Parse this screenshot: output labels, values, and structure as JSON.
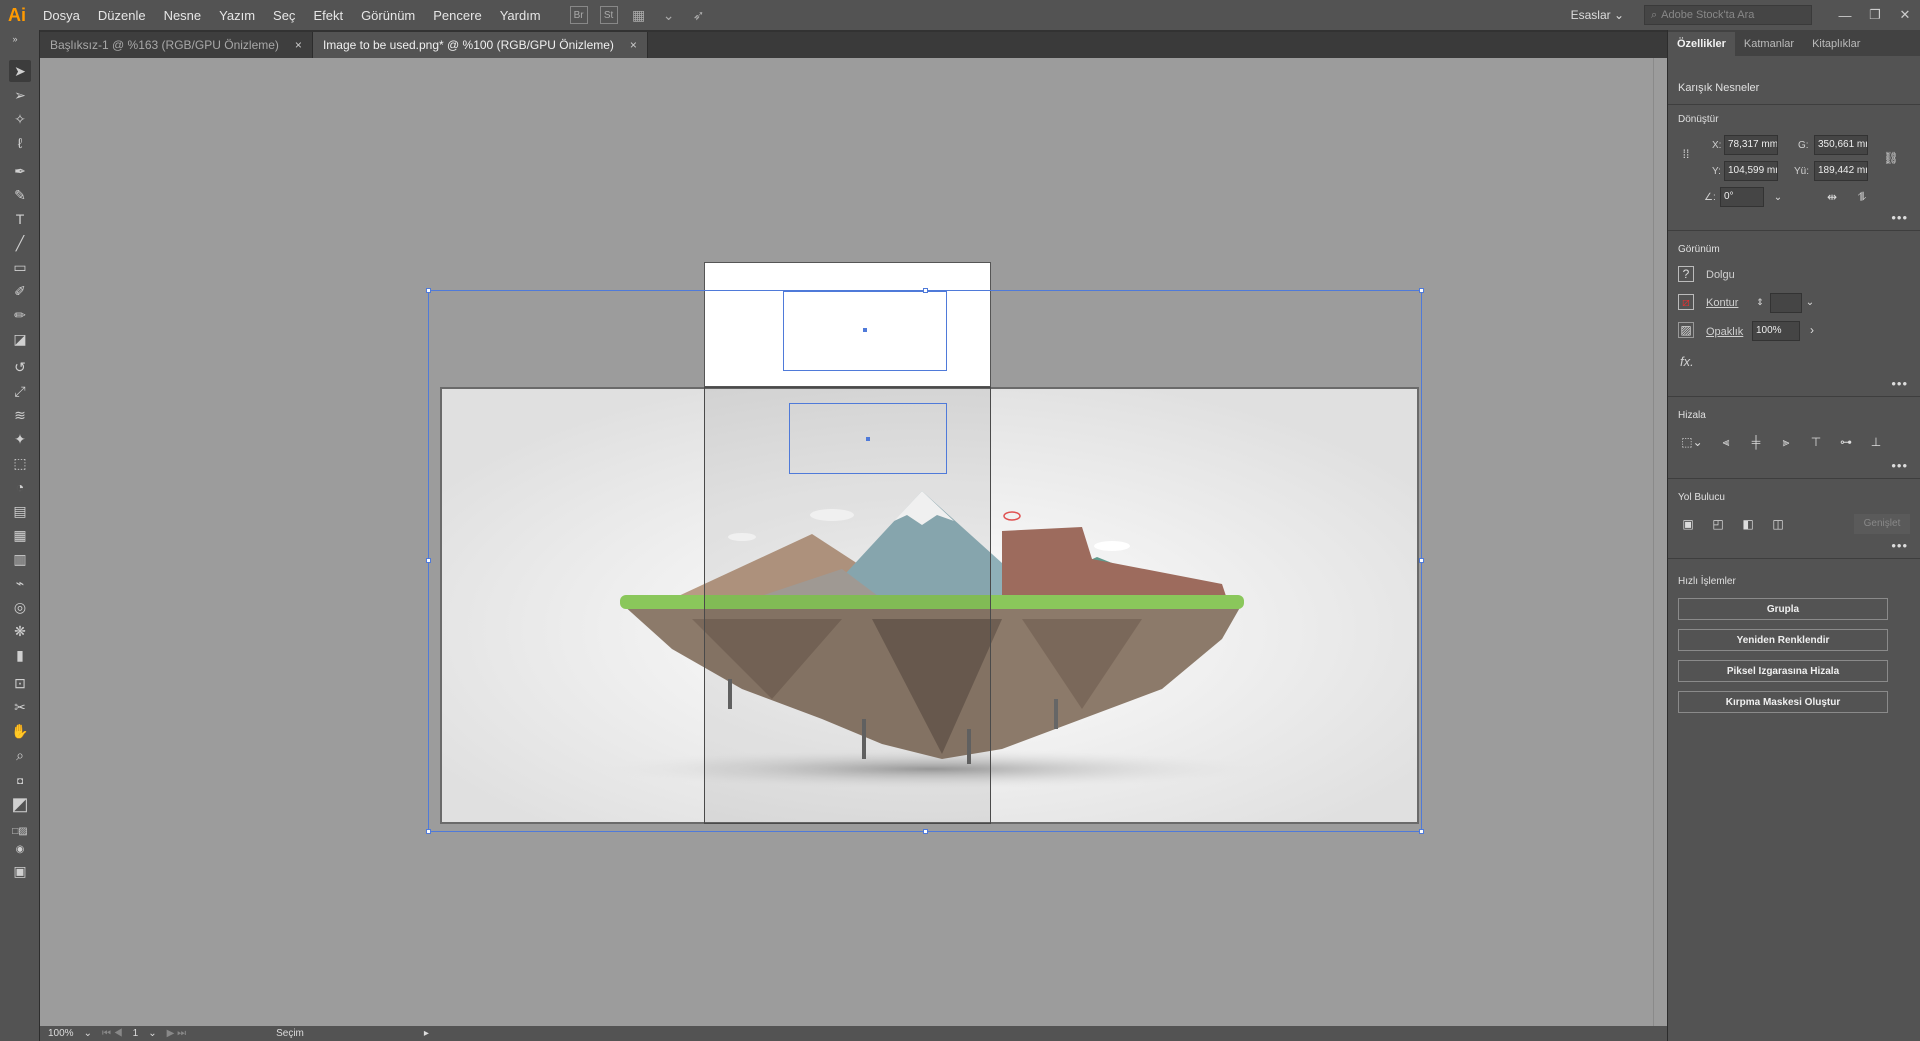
{
  "app": {
    "logo": "Ai"
  },
  "menu": [
    "Dosya",
    "Düzenle",
    "Nesne",
    "Yazım",
    "Seç",
    "Efekt",
    "Görünüm",
    "Pencere",
    "Yardım"
  ],
  "menu_icons": {
    "br": "Br",
    "st": "St"
  },
  "workspace": "Esaslar",
  "stock_search_placeholder": "Adobe Stock'ta Ara",
  "tabs": [
    {
      "label": "Başlıksız-1 @ %163 (RGB/GPU Önizleme)",
      "close": "×"
    },
    {
      "label": "Image to be used.png* @ %100 (RGB/GPU Önizleme)",
      "close": "×"
    }
  ],
  "status": {
    "zoom": "100%",
    "artboard": "1",
    "tool": "Seçim"
  },
  "panel": {
    "tabs": [
      "Özellikler",
      "Katmanlar",
      "Kitaplıklar"
    ],
    "object_type": "Karışık Nesneler",
    "transform": {
      "title": "Dönüştür",
      "x_label": "X:",
      "x": "78,317 mm",
      "y_label": "Y:",
      "y": "104,599 mr",
      "w_label": "G:",
      "w": "350,661 mr",
      "h_label": "Yü:",
      "h": "189,442 mr",
      "angle_label": "∠:",
      "angle": "0°"
    },
    "appearance": {
      "title": "Görünüm",
      "fill": "Dolgu",
      "stroke": "Kontur",
      "opacity_label": "Opaklık",
      "opacity": "100%",
      "fx": "fx."
    },
    "align": {
      "title": "Hizala"
    },
    "pathfinder": {
      "title": "Yol Bulucu",
      "expand": "Genişlet"
    },
    "quick_actions": {
      "title": "Hızlı İşlemler",
      "buttons": [
        "Grupla",
        "Yeniden Renklendir",
        "Piksel Izgarasına Hizala",
        "Kırpma Maskesi Oluştur"
      ]
    }
  }
}
